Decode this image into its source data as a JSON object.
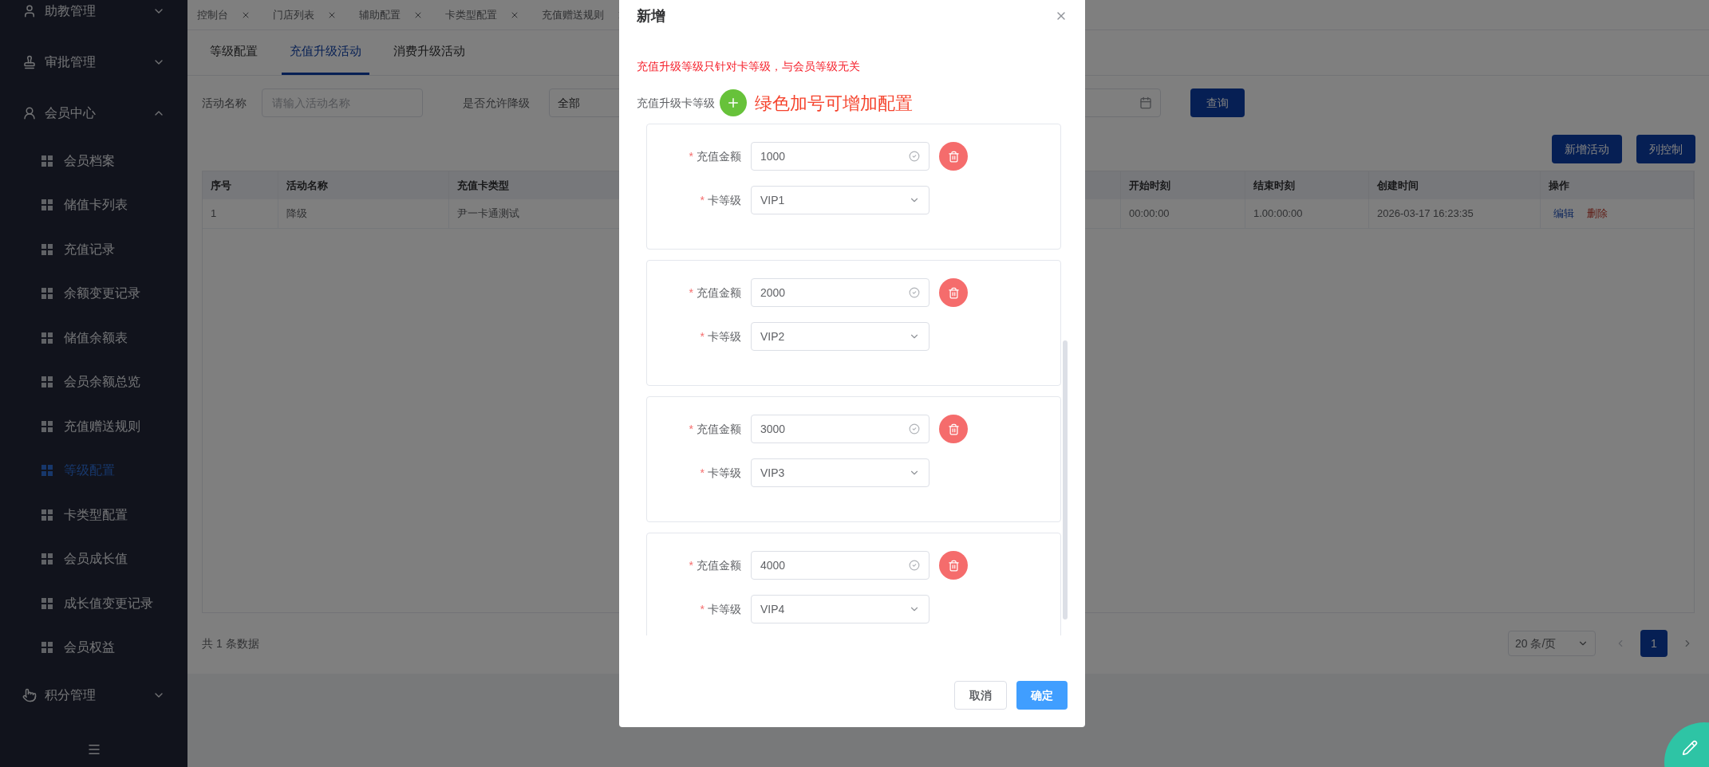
{
  "sidebar": {
    "items": [
      {
        "label": "助教管理",
        "expanded": false
      },
      {
        "label": "审批管理",
        "expanded": false
      },
      {
        "label": "会员中心",
        "expanded": true,
        "children": [
          {
            "label": "会员档案",
            "selected": false
          },
          {
            "label": "储值卡列表",
            "selected": false
          },
          {
            "label": "充值记录",
            "selected": false
          },
          {
            "label": "余额变更记录",
            "selected": false
          },
          {
            "label": "储值余额表",
            "selected": false
          },
          {
            "label": "会员余额总览",
            "selected": false
          },
          {
            "label": "充值赠送规则",
            "selected": false
          },
          {
            "label": "等级配置",
            "selected": true
          },
          {
            "label": "卡类型配置",
            "selected": false
          },
          {
            "label": "会员成长值",
            "selected": false
          },
          {
            "label": "成长值变更记录",
            "selected": false
          },
          {
            "label": "会员权益",
            "selected": false
          }
        ]
      },
      {
        "label": "积分管理",
        "expanded": false
      }
    ]
  },
  "tag_tabs": [
    {
      "label": "控制台"
    },
    {
      "label": "门店列表"
    },
    {
      "label": "辅助配置"
    },
    {
      "label": "卡类型配置"
    },
    {
      "label": "充值赠送规则"
    }
  ],
  "tabs": [
    {
      "label": "等级配置",
      "selected": false
    },
    {
      "label": "充值升级活动",
      "selected": true
    },
    {
      "label": "消费升级活动",
      "selected": false
    }
  ],
  "filters": [
    {
      "kind": "input",
      "label": "活动名称",
      "placeholder": "请输入活动名称"
    },
    {
      "kind": "select",
      "label": "是否允许降级",
      "value": "全部"
    },
    {
      "kind": "date"
    }
  ],
  "search_button": "查询",
  "toolbar_buttons": [
    "新增活动",
    "列控制"
  ],
  "table": {
    "columns": [
      "序号",
      "活动名称",
      "充值卡类型",
      "开始时刻",
      "结束时刻",
      "创建时间",
      "操作"
    ],
    "rows": [
      {
        "cells": [
          "1",
          "降级",
          "尹一卡通测试",
          "00:00:00",
          "1.00:00:00",
          "2026-03-17 16:23:35"
        ],
        "actions": [
          {
            "label": "编辑",
            "kind": "edit"
          },
          {
            "label": "删除",
            "kind": "delete"
          }
        ]
      }
    ]
  },
  "pagination": {
    "total": "共 1 条数据",
    "page_size": "20 条/页",
    "pages": [
      {
        "label": "1",
        "selected": true
      }
    ]
  },
  "dialog": {
    "title": "新增",
    "notice": "充值升级等级只针对卡等级，与会员等级无关",
    "section_label": "充值升级卡等级",
    "hint": "绿色加号可增加配置",
    "tiers": [
      {
        "fields": [
          {
            "kind": "input",
            "mark": "*",
            "label": "充值金额",
            "value": "1000"
          },
          {
            "kind": "select",
            "mark": "*",
            "label": "卡等级",
            "value": "VIP1"
          }
        ]
      },
      {
        "fields": [
          {
            "kind": "input",
            "mark": "*",
            "label": "充值金额",
            "value": "2000"
          },
          {
            "kind": "select",
            "mark": "*",
            "label": "卡等级",
            "value": "VIP2"
          }
        ]
      },
      {
        "fields": [
          {
            "kind": "input",
            "mark": "*",
            "label": "充值金额",
            "value": "3000"
          },
          {
            "kind": "select",
            "mark": "*",
            "label": "卡等级",
            "value": "VIP3"
          }
        ]
      },
      {
        "fields": [
          {
            "kind": "input",
            "mark": "*",
            "label": "充值金额",
            "value": "4000"
          },
          {
            "kind": "select",
            "mark": "*",
            "label": "卡等级",
            "value": "VIP4"
          }
        ]
      }
    ],
    "buttons": [
      {
        "label": "取消",
        "kind": "secondary"
      },
      {
        "label": "确定",
        "kind": "primary"
      }
    ]
  }
}
